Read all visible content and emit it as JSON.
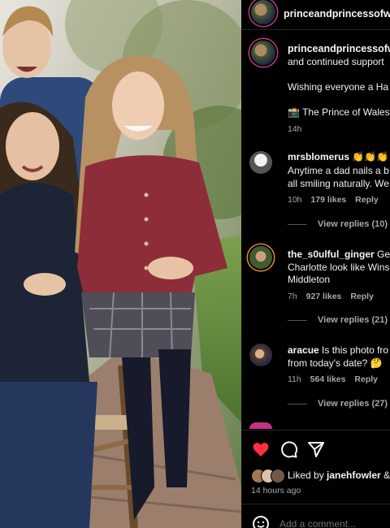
{
  "post": {
    "author_handle": "princeandprincessofw",
    "caption_handle": "princeandprincessofw",
    "caption_lines": [
      "and continued support",
      "",
      "Wishing everyone a Ha",
      "",
      "📸 The Prince of Wales"
    ],
    "caption_time": "14h"
  },
  "comments": [
    {
      "handle": "mrsblomerus",
      "first_line": "👏👏👏 T",
      "lines": [
        "Anytime a dad nails a b",
        "all smiling naturally. We"
      ],
      "time": "10h",
      "likes": "179 likes",
      "reply": "Reply",
      "view_replies": "View replies (10)"
    },
    {
      "handle": "the_s0ulful_ginger",
      "first_line": "Ge",
      "lines": [
        "Charlotte look like Wins",
        "Middleton"
      ],
      "time": "7h",
      "likes": "927 likes",
      "reply": "Reply",
      "view_replies": "View replies (21)"
    },
    {
      "handle": "aracue",
      "first_line": "Is this photo fro",
      "lines": [
        "from today's date? 🤔"
      ],
      "time": "11h",
      "likes": "564 likes",
      "reply": "Reply",
      "view_replies": "View replies (27)"
    }
  ],
  "actions": {
    "like_icon": "heart-filled-icon",
    "comment_icon": "comment-icon",
    "share_icon": "share-icon",
    "liked_by_prefix": "Liked by",
    "liked_by_user": "janehfowler",
    "liked_by_suffix": "&",
    "time_ago": "14 hours ago"
  },
  "composer": {
    "placeholder": "Add a comment...",
    "emoji_icon": "emoji-icon"
  },
  "colors": {
    "background": "#000000",
    "like": "#ff3040",
    "secondary_text": "#a8a8a8"
  }
}
